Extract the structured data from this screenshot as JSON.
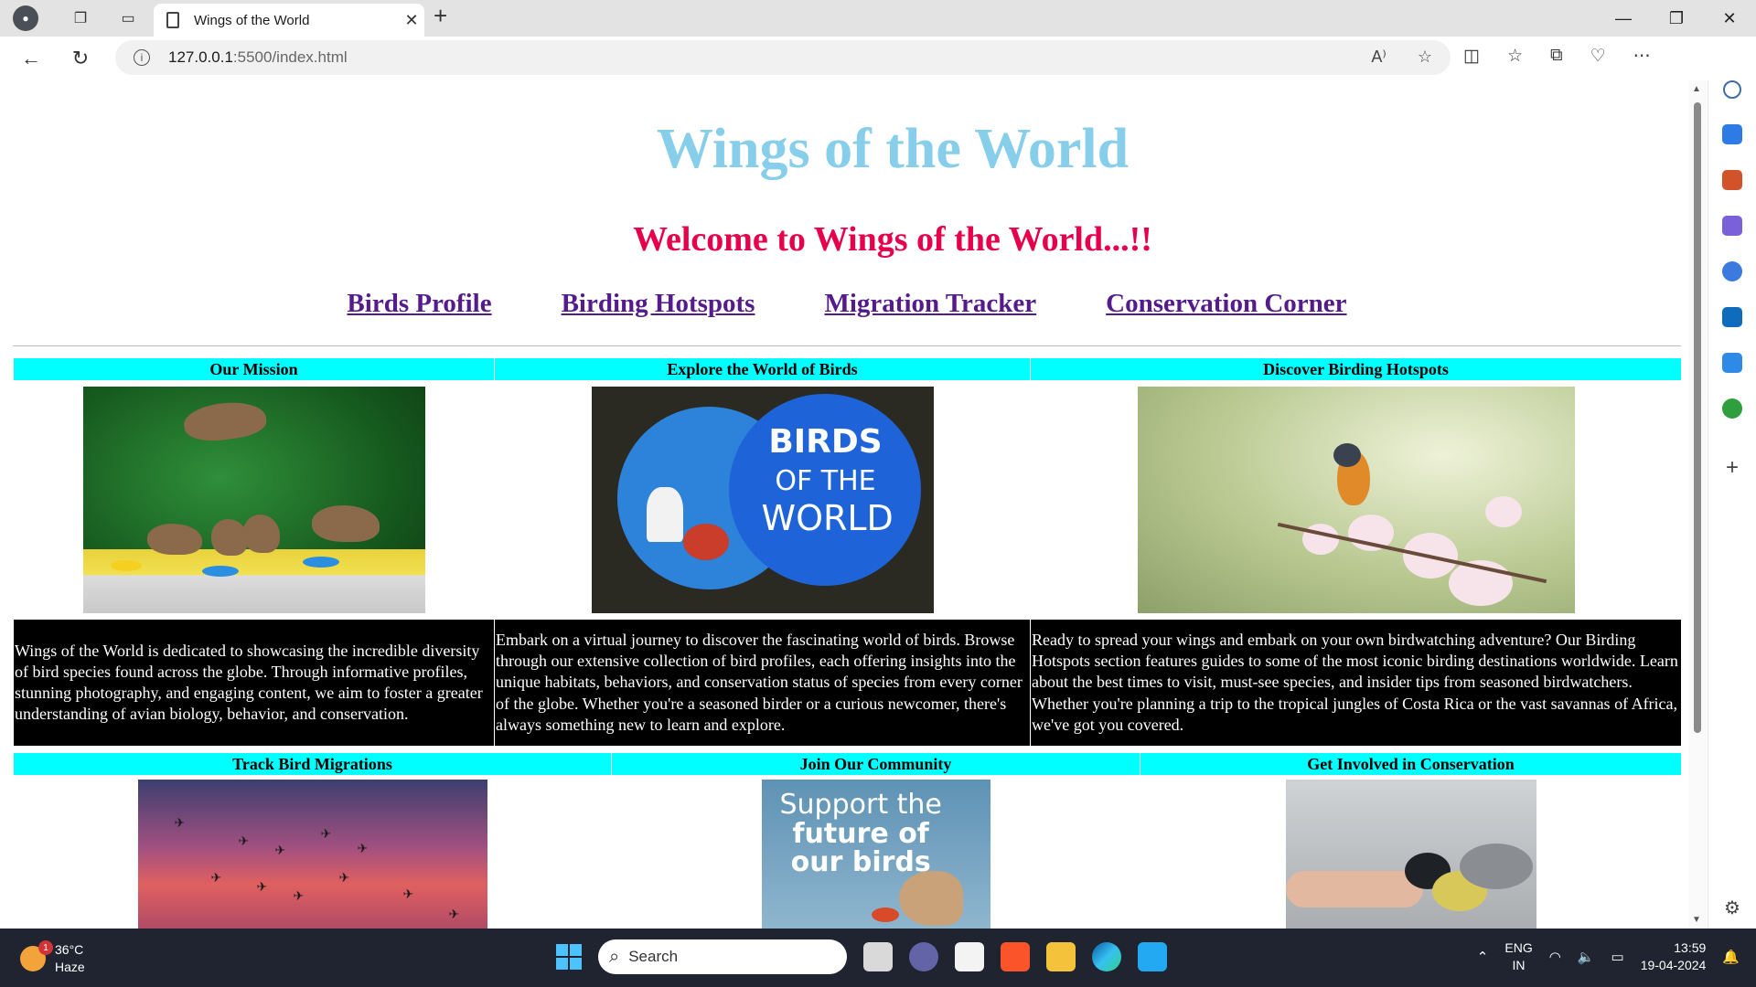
{
  "browser": {
    "tab_title": "Wings of the World",
    "url_host": "127.0.0.1",
    "url_path": ":5500/index.html",
    "close_tab_symbol": "✕",
    "new_tab_symbol": "+"
  },
  "page": {
    "title": "Wings of the World",
    "welcome": "Welcome to Wings of the World...!!",
    "nav": [
      "Birds Profile",
      "Birding Hotspots",
      "Migration Tracker",
      "Conservation Corner"
    ],
    "row1": {
      "headers": [
        "Our Mission",
        "Explore the World of Birds",
        "Discover Birding Hotspots"
      ],
      "texts": [
        "Wings of the World is dedicated to showcasing the incredible diversity of bird species found across the globe. Through informative profiles, stunning photography, and engaging content, we aim to foster a greater understanding of avian biology, behavior, and conservation.",
        "Embark on a virtual journey to discover the fascinating world of birds. Browse through our extensive collection of bird profiles, each offering insights into the unique habitats, behaviors, and conservation status of species from every corner of the globe. Whether you're a seasoned birder or a curious newcomer, there's always something new to learn and explore.",
        "Ready to spread your wings and embark on your own birdwatching adventure? Our Birding Hotspots section features guides to some of the most iconic birding destinations worldwide. Learn about the best times to visit, must-see species, and insider tips from seasoned birdwatchers. Whether you're planning a trip to the tropical jungles of Costa Rica or the vast savannas of Africa, we've got you covered."
      ],
      "image_texts": {
        "globe_line1": "BIRDS",
        "globe_line2": "OF THE",
        "globe_line3": "WORLD"
      }
    },
    "row2": {
      "headers": [
        "Track Bird Migrations",
        "Join Our Community",
        "Get Involved in Conservation"
      ],
      "image_texts": {
        "support_line1": "Support the",
        "support_line2": "future of",
        "support_line3": "our birds"
      }
    }
  },
  "taskbar": {
    "weather_temp": "36°C",
    "weather_desc": "Haze",
    "weather_badge": "1",
    "search_label": "Search",
    "lang_line1": "ENG",
    "lang_line2": "IN",
    "time": "13:59",
    "date": "19-04-2024"
  },
  "colors": {
    "title": "#87ceeb",
    "welcome": "#e6004c",
    "nav_link": "#551a8b",
    "header_bg": "#00ffff",
    "text_bg": "#000000"
  }
}
